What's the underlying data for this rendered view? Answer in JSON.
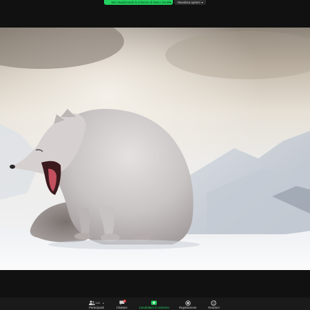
{
  "top_banner": {
    "share_status": "Stai visualizzando lo schermo di Marco Gentili",
    "view_options": "Visualizza opzioni"
  },
  "toolbar": {
    "participants": {
      "label": "Partecipanti",
      "count": "141"
    },
    "chat": {
      "label": "Chattare",
      "badge": "1"
    },
    "share_screen": {
      "label": "Condividere lo schermo"
    },
    "record": {
      "label": "Registrazione"
    },
    "reactions": {
      "label": "Reazioni"
    }
  },
  "colors": {
    "accent_green": "#23d160",
    "toolbar_bg": "#1a1a1a",
    "window_bg": "#111111"
  },
  "icons": {
    "participants": "people-icon",
    "chat": "chat-bubble-icon",
    "share": "share-screen-icon",
    "record": "record-icon",
    "reactions": "smiley-icon"
  }
}
